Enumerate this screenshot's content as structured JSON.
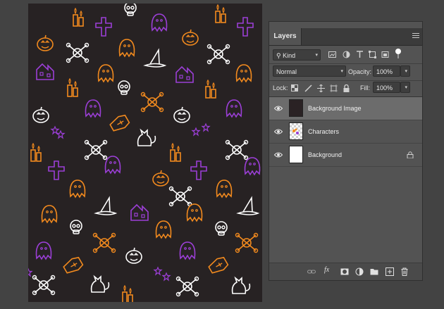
{
  "layers_panel": {
    "tab_label": "Layers",
    "filter": {
      "value": "Kind"
    },
    "blend_mode": {
      "value": "Normal"
    },
    "opacity": {
      "label": "Opacity:",
      "value": "100%"
    },
    "lock": {
      "label": "Lock:"
    },
    "fill": {
      "label": "Fill:",
      "value": "100%"
    },
    "layers": [
      {
        "name": "Background Image",
        "selected": true,
        "thumb": "dark-pattern",
        "locked": false
      },
      {
        "name": "Characters",
        "selected": false,
        "thumb": "transparent-with-art",
        "locked": false
      },
      {
        "name": "Background",
        "selected": false,
        "thumb": "white",
        "locked": true
      }
    ],
    "footer_icons": [
      "link-icon",
      "fx-icon",
      "mask-icon",
      "adjustment-icon",
      "folder-icon",
      "new-layer-icon",
      "trash-icon"
    ]
  },
  "colors": {
    "canvas_bg": "#272223",
    "purple": "#9b3fd6",
    "orange": "#f28a1e",
    "white": "#ffffff"
  }
}
